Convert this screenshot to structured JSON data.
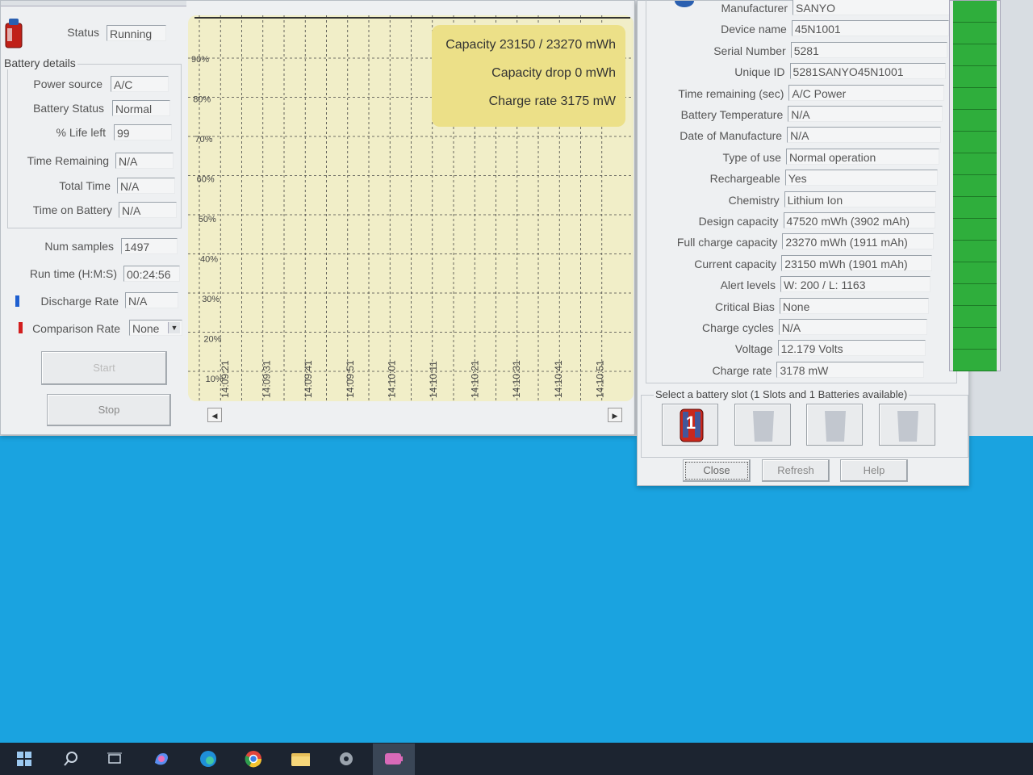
{
  "left_panel": {
    "status_label": "Status",
    "status_value": "Running",
    "battery_details_title": "Battery details",
    "fields": [
      {
        "label": "Power source",
        "value": "A/C"
      },
      {
        "label": "Battery Status",
        "value": "Normal"
      },
      {
        "label": "% Life left",
        "value": "99"
      },
      {
        "label": "Time Remaining",
        "value": "N/A"
      },
      {
        "label": "Total Time",
        "value": "N/A"
      },
      {
        "label": "Time on Battery",
        "value": "N/A"
      }
    ],
    "num_samples_label": "Num samples",
    "num_samples_value": "1497",
    "run_time_label": "Run time (H:M:S)",
    "run_time_value": "00:24:56",
    "discharge_rate_label": "Discharge Rate",
    "discharge_rate_value": "N/A",
    "comparison_rate_label": "Comparison Rate",
    "comparison_rate_value": "None",
    "start_label": "Start",
    "stop_label": "Stop"
  },
  "chart": {
    "info_box": {
      "capacity": "Capacity 23150 / 23270 mWh",
      "capacity_drop": "Capacity drop 0 mWh",
      "charge_rate": "Charge rate 3175 mW"
    },
    "y_ticks": [
      "90%",
      "80%",
      "70%",
      "60%",
      "50%",
      "40%",
      "30%",
      "20%",
      "10%"
    ],
    "x_ticks": [
      "14:09:21",
      "14:09:31",
      "14:09:41",
      "14:09:51",
      "14:10:01",
      "14:10:11",
      "14:10:21",
      "14:10:31",
      "14:10:41",
      "14:10:51"
    ],
    "scroll_left_icon": "arrow-left-icon",
    "scroll_right_icon": "arrow-right-icon"
  },
  "right_panel": {
    "fields": [
      {
        "label": "Manufacturer",
        "value": "SANYO"
      },
      {
        "label": "Device name",
        "value": "45N1001"
      },
      {
        "label": "Serial Number",
        "value": "5281"
      },
      {
        "label": "Unique ID",
        "value": "5281SANYO45N1001"
      },
      {
        "label": "Time remaining (sec)",
        "value": "A/C Power"
      },
      {
        "label": "Battery Temperature",
        "value": "N/A"
      },
      {
        "label": "Date of Manufacture",
        "value": "N/A"
      },
      {
        "label": "Type of use",
        "value": "Normal operation"
      },
      {
        "label": "Rechargeable",
        "value": "Yes"
      },
      {
        "label": "Chemistry",
        "value": "Lithium Ion"
      },
      {
        "label": "Design capacity",
        "value": "47520 mWh (3902 mAh)"
      },
      {
        "label": "Full charge capacity",
        "value": "23270 mWh (1911 mAh)"
      },
      {
        "label": "Current capacity",
        "value": "23150 mWh (1901 mAh)"
      },
      {
        "label": "Alert levels",
        "value": "W: 200 / L: 1163"
      },
      {
        "label": "Critical Bias",
        "value": "None"
      },
      {
        "label": "Charge cycles",
        "value": "N/A"
      },
      {
        "label": "Voltage",
        "value": "12.179 Volts"
      },
      {
        "label": "Charge rate",
        "value": "3178 mW"
      }
    ],
    "slot_group_title": "Select a battery slot (1 Slots and 1 Batteries available)",
    "slot_1_label": "1",
    "close_label": "Close",
    "refresh_label": "Refresh",
    "help_label": "Help",
    "charge_level_fraction": 0.99
  },
  "taskbar": {
    "icons": [
      "windows-start-icon",
      "search-icon",
      "task-view-icon",
      "copilot-icon",
      "edge-icon",
      "chrome-icon",
      "file-explorer-icon",
      "settings-icon",
      "battery-app-icon"
    ]
  },
  "colors": {
    "chart_bg": "#f1eec8",
    "info_box": "#ece088",
    "level_green": "#2fae3c",
    "desktop": "#1aa3e0",
    "discharge_marker": "#1e5fd0",
    "comparison_marker": "#d21e1e"
  }
}
